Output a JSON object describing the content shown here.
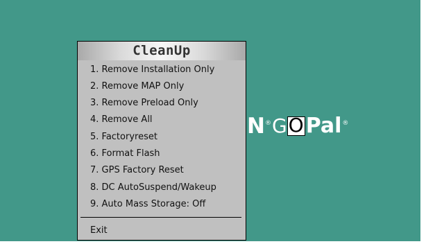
{
  "colors": {
    "screen_background": "#429889",
    "menu_background": "#c0c0c0",
    "menu_text": "#111111",
    "logo_text": "#ffffff"
  },
  "logo": {
    "n_part": "N",
    "reg_mark": "®",
    "go_prefix": "G",
    "go_o": "O",
    "pal": "Pal",
    "reg_mark_2": "®"
  },
  "menu": {
    "title": "CleanUp",
    "items": [
      {
        "label": "1. Remove Installation Only"
      },
      {
        "label": "2. Remove MAP Only"
      },
      {
        "label": "3. Remove Preload Only"
      },
      {
        "label": "4. Remove All"
      },
      {
        "label": "5. Factoryreset"
      },
      {
        "label": "6. Format Flash"
      },
      {
        "label": "7. GPS Factory Reset"
      },
      {
        "label": "8. DC AutoSuspend/Wakeup"
      },
      {
        "label": "9. Auto Mass Storage: Off"
      }
    ],
    "exit_label": "Exit"
  }
}
